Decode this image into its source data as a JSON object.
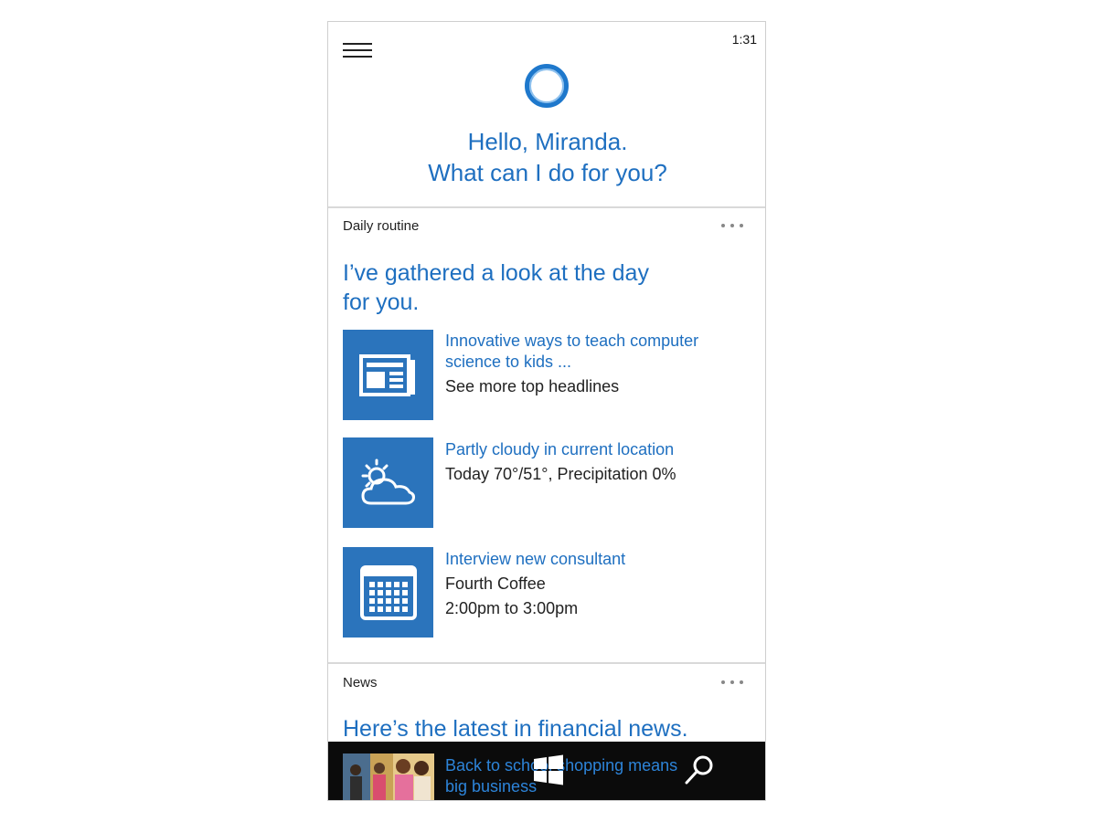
{
  "status": {
    "time": "1:31"
  },
  "header": {
    "greeting_line1": "Hello, Miranda.",
    "greeting_line2": "What can I do for you?"
  },
  "daily_routine": {
    "label": "Daily routine",
    "headline_line1": "I’ve gathered a look at the day",
    "headline_line2": "for you.",
    "items": [
      {
        "icon": "newspaper-icon",
        "link_line1": "Innovative ways to teach computer",
        "link_line2": "science to kids ...",
        "sub": [
          "See more top headlines"
        ]
      },
      {
        "icon": "partly-cloudy-icon",
        "link_line1": "Partly cloudy in current location",
        "sub": [
          "Today 70°/51°, Precipitation 0%"
        ]
      },
      {
        "icon": "calendar-icon",
        "link_line1": "Interview new consultant",
        "sub": [
          "Fourth Coffee",
          "2:00pm to 3:00pm"
        ]
      }
    ]
  },
  "news": {
    "label": "News",
    "headline": "Here’s the latest in financial news.",
    "article_line1": "Back to school shopping means",
    "article_line2": "big business"
  },
  "colors": {
    "accent": "#1e6fc0",
    "tile": "#2b74bc",
    "taskbar": "#0b0b0b"
  }
}
